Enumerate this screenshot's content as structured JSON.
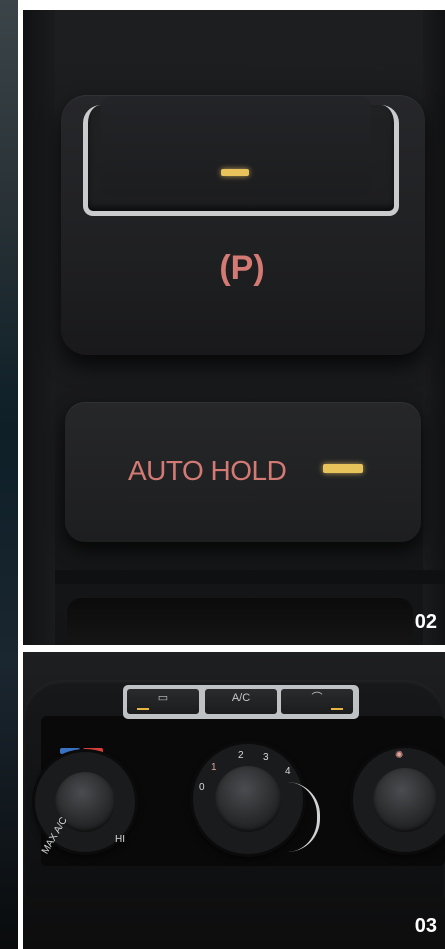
{
  "parking_brake": {
    "symbol": "(P)",
    "indicator_color": "#e8c35c",
    "symbol_color": "#d27a73"
  },
  "auto_hold": {
    "label": "AUTO HOLD",
    "label_color": "#d47a74"
  },
  "top_panel": {
    "page_number": "02"
  },
  "climate": {
    "buttons": [
      {
        "label": "▭",
        "name": "rear-defrost"
      },
      {
        "label": "A/C",
        "name": "ac"
      },
      {
        "label": "⌒",
        "name": "recirculation"
      }
    ],
    "fan_speeds": [
      "0",
      "1",
      "2",
      "3",
      "4"
    ],
    "temp_left_label": "MAX A/C",
    "temp_right_label": "HI"
  },
  "bottom_panel": {
    "page_number": "03"
  }
}
